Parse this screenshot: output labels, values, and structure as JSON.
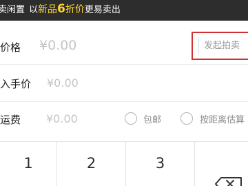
{
  "banner": {
    "part1": "卖闲置",
    "part2": "以",
    "highlight1": "新品",
    "number": "6",
    "highlight2": "折价",
    "part3": "更易卖出"
  },
  "price": {
    "label": "价格",
    "placeholder": "¥0.00",
    "auction_button": "发起拍卖"
  },
  "cost_price": {
    "label": "入手价",
    "placeholder": "¥0.00"
  },
  "shipping": {
    "label": "运费",
    "placeholder": "¥0.00",
    "options": [
      {
        "label": "包邮",
        "selected": false
      },
      {
        "label": "按距离估算",
        "selected": false
      }
    ]
  },
  "keypad": {
    "keys": [
      "1",
      "2",
      "3"
    ],
    "delete_icon": "backspace-icon"
  },
  "colors": {
    "banner_bg": "#2d2d2d",
    "highlight": "#ffd531",
    "annotation_box": "#d33131"
  }
}
